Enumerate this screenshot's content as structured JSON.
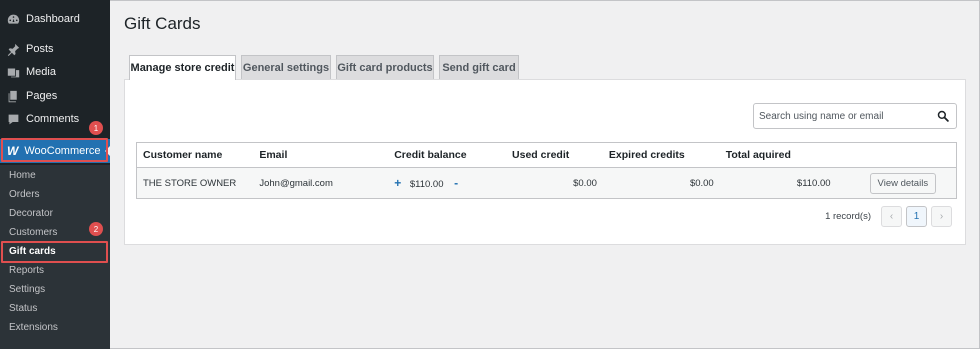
{
  "sidebar": {
    "menu": [
      {
        "label": "Dashboard",
        "icon": "dashboard-icon"
      },
      {
        "label": "Posts",
        "icon": "pushpin-icon"
      },
      {
        "label": "Media",
        "icon": "media-icon"
      },
      {
        "label": "Pages",
        "icon": "pages-icon"
      },
      {
        "label": "Comments",
        "icon": "comment-icon"
      }
    ],
    "woocommerce": {
      "label": "WooCommerce",
      "logo": "W"
    },
    "submenu": [
      {
        "label": "Home"
      },
      {
        "label": "Orders"
      },
      {
        "label": "Decorator"
      },
      {
        "label": "Customers"
      },
      {
        "label": "Gift cards"
      },
      {
        "label": "Reports"
      },
      {
        "label": "Settings"
      },
      {
        "label": "Status"
      },
      {
        "label": "Extensions"
      }
    ],
    "callouts": [
      "1",
      "2"
    ]
  },
  "page": {
    "title": "Gift Cards"
  },
  "tabs": [
    {
      "label": "Manage store credit"
    },
    {
      "label": "General settings"
    },
    {
      "label": "Gift card products"
    },
    {
      "label": "Send gift card"
    }
  ],
  "search": {
    "placeholder": "Search using name or email"
  },
  "table": {
    "columns": [
      "Customer name",
      "Email",
      "Credit balance",
      "Used credit",
      "Expired credits",
      "Total aquired",
      ""
    ],
    "rows": [
      {
        "name": "THE STORE OWNER",
        "email": "John@gmail.com",
        "plus": "+",
        "balance": "$110.00",
        "minus": "-",
        "used": "$0.00",
        "expired": "$0.00",
        "total": "$110.00",
        "action": "View details"
      }
    ]
  },
  "pagination": {
    "records": "1 record(s)",
    "prev": "‹",
    "page": "1",
    "next": "›"
  },
  "colors": {
    "accent": "#2271b1",
    "sidebar": "#1d2327",
    "highlight": "#e04f4f"
  }
}
